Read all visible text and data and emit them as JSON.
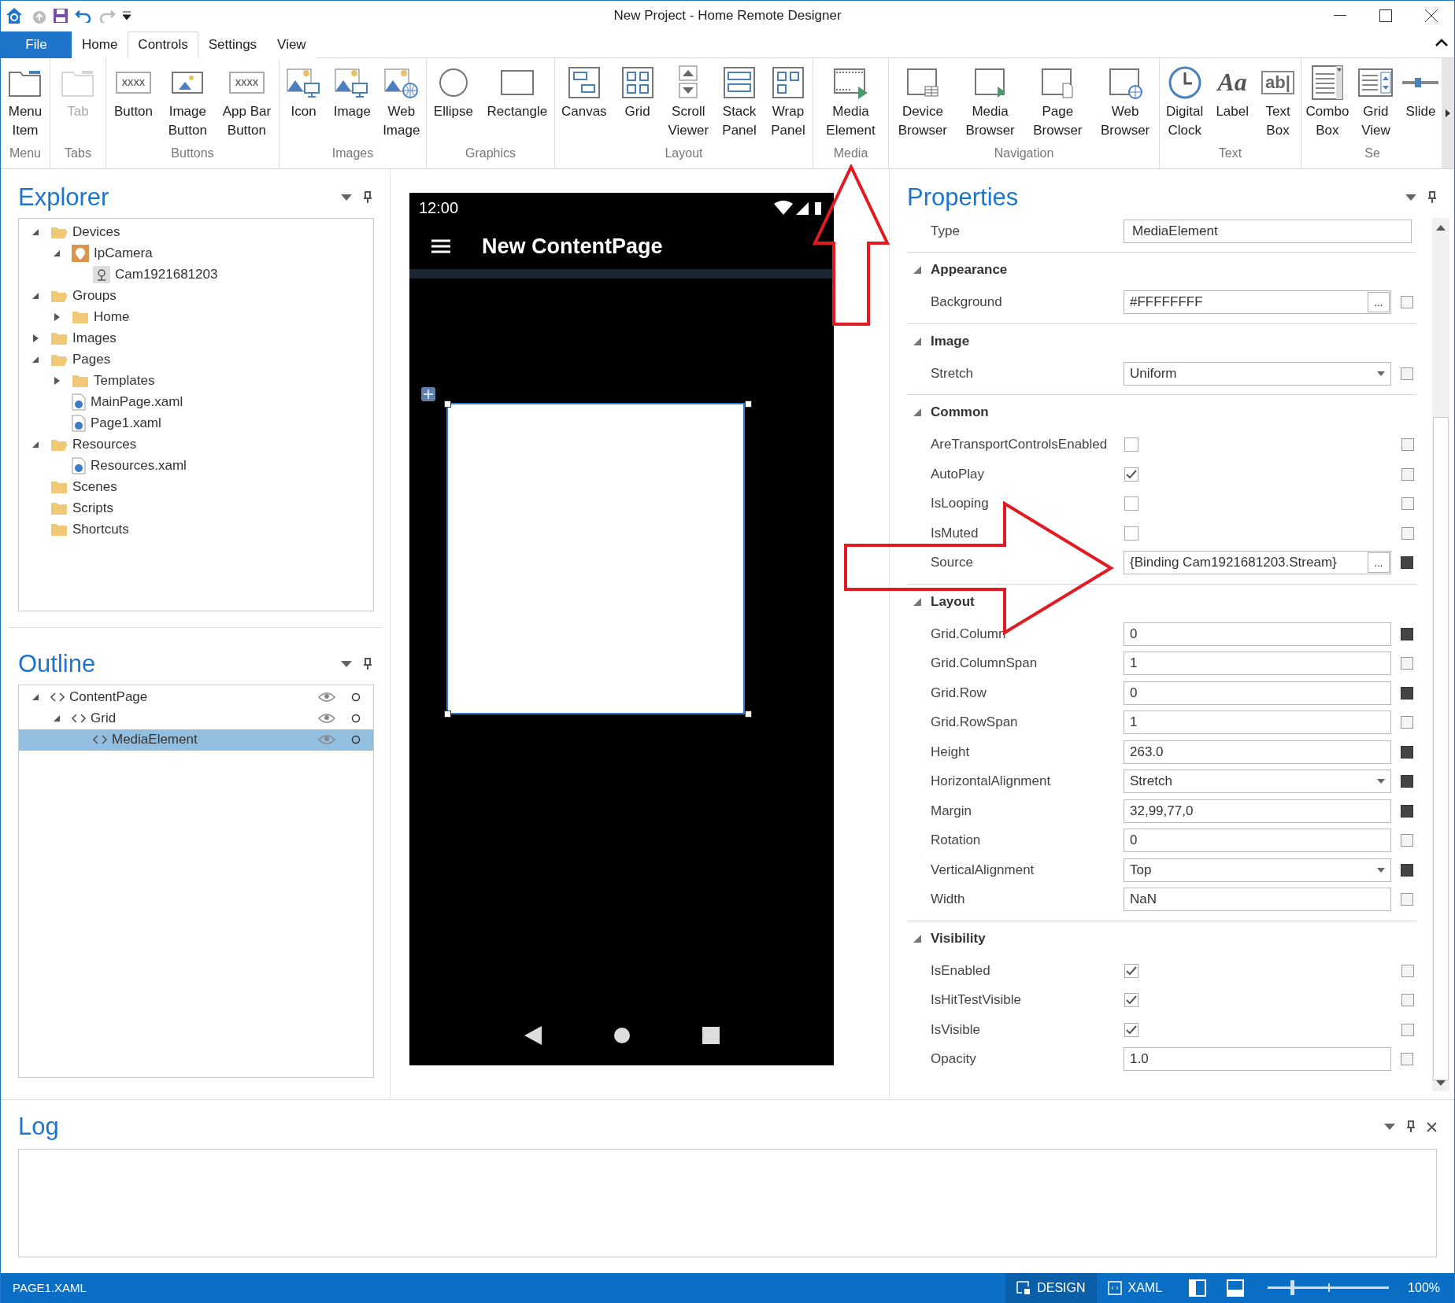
{
  "window": {
    "title": "New Project - Home Remote Designer"
  },
  "ribbon_tabs": [
    {
      "label": "File",
      "kind": "file",
      "selected": false
    },
    {
      "label": "Home",
      "kind": "tab",
      "selected": false
    },
    {
      "label": "Controls",
      "kind": "tab",
      "selected": true
    },
    {
      "label": "Settings",
      "kind": "tab",
      "selected": false
    },
    {
      "label": "View",
      "kind": "tab",
      "selected": false
    }
  ],
  "ribbon_groups": [
    {
      "label": "Menu",
      "items": [
        {
          "label": "Menu\nItem",
          "disabled": false
        }
      ]
    },
    {
      "label": "Tabs",
      "items": [
        {
          "label": "Tab",
          "disabled": true
        }
      ]
    },
    {
      "label": "Buttons",
      "items": [
        {
          "label": "Button",
          "glyph": "XXXX",
          "disabled": false
        },
        {
          "label": "Image\nButton",
          "disabled": false
        },
        {
          "label": "App Bar\nButton",
          "glyph": "XXXX",
          "disabled": false
        }
      ]
    },
    {
      "label": "Images",
      "items": [
        {
          "label": "Icon",
          "disabled": false
        },
        {
          "label": "Image",
          "disabled": false
        },
        {
          "label": "Web\nImage",
          "disabled": false
        }
      ]
    },
    {
      "label": "Graphics",
      "items": [
        {
          "label": "Ellipse",
          "disabled": false
        },
        {
          "label": "Rectangle",
          "disabled": false
        }
      ]
    },
    {
      "label": "Layout",
      "items": [
        {
          "label": "Canvas",
          "disabled": false
        },
        {
          "label": "Grid",
          "disabled": false
        },
        {
          "label": "Scroll\nViewer",
          "disabled": false
        },
        {
          "label": "Stack\nPanel",
          "disabled": false
        },
        {
          "label": "Wrap\nPanel",
          "disabled": false
        }
      ]
    },
    {
      "label": "Media",
      "items": [
        {
          "label": "Media\nElement",
          "disabled": false
        }
      ]
    },
    {
      "label": "Navigation",
      "items": [
        {
          "label": "Device\nBrowser",
          "disabled": false
        },
        {
          "label": "Media\nBrowser",
          "disabled": false
        },
        {
          "label": "Page\nBrowser",
          "disabled": false
        },
        {
          "label": "Web\nBrowser",
          "disabled": false
        }
      ]
    },
    {
      "label": "Text",
      "items": [
        {
          "label": "Digital\nClock",
          "disabled": false
        },
        {
          "label": "Label",
          "glyph": "Aa",
          "disabled": false
        },
        {
          "label": "Text\nBox",
          "glyph": "ab|",
          "disabled": false
        }
      ]
    },
    {
      "label": "Se",
      "items": [
        {
          "label": "Combo\nBox",
          "disabled": false
        },
        {
          "label": "Grid\nView",
          "disabled": false
        },
        {
          "label": "Slide",
          "disabled": false
        }
      ]
    }
  ],
  "explorer": {
    "title": "Explorer",
    "tree": [
      {
        "label": "Devices",
        "kind": "folder",
        "expanded": true,
        "children": [
          {
            "label": "IpCamera",
            "kind": "device",
            "expanded": true,
            "children": [
              {
                "label": "Cam1921681203",
                "kind": "camera"
              }
            ]
          }
        ]
      },
      {
        "label": "Groups",
        "kind": "folder",
        "expanded": true,
        "children": [
          {
            "label": "Home",
            "kind": "folder",
            "expanded": false
          }
        ]
      },
      {
        "label": "Images",
        "kind": "folder",
        "expanded": false
      },
      {
        "label": "Pages",
        "kind": "folder",
        "expanded": true,
        "children": [
          {
            "label": "Templates",
            "kind": "folder",
            "expanded": false
          },
          {
            "label": "MainPage.xaml",
            "kind": "file"
          },
          {
            "label": "Page1.xaml",
            "kind": "file"
          }
        ]
      },
      {
        "label": "Resources",
        "kind": "folder",
        "expanded": true,
        "children": [
          {
            "label": "Resources.xaml",
            "kind": "file"
          }
        ]
      },
      {
        "label": "Scenes",
        "kind": "folder"
      },
      {
        "label": "Scripts",
        "kind": "folder"
      },
      {
        "label": "Shortcuts",
        "kind": "folder"
      }
    ]
  },
  "outline": {
    "title": "Outline",
    "tree": [
      {
        "label": "ContentPage",
        "expanded": true,
        "selected": false,
        "children": [
          {
            "label": "Grid",
            "expanded": true,
            "selected": false,
            "children": [
              {
                "label": "MediaElement",
                "selected": true
              }
            ]
          }
        ]
      }
    ]
  },
  "designer": {
    "time": "12:00",
    "page_title": "New ContentPage"
  },
  "properties": {
    "title": "Properties",
    "type": {
      "label": "Type",
      "value": "MediaElement"
    },
    "sections": [
      {
        "title": "Appearance",
        "expanded": true,
        "rows": [
          {
            "label": "Background",
            "kind": "button-field",
            "value": "#FFFFFFFF",
            "button": "...",
            "set": false
          }
        ]
      },
      {
        "title": "Image",
        "expanded": true,
        "rows": [
          {
            "label": "Stretch",
            "kind": "dropdown",
            "value": "Uniform",
            "set": false
          }
        ]
      },
      {
        "title": "Common",
        "expanded": true,
        "rows": [
          {
            "label": "AreTransportControlsEnabled",
            "kind": "checkbox",
            "checked": false,
            "set": false
          },
          {
            "label": "AutoPlay",
            "kind": "checkbox",
            "checked": true,
            "set": false
          },
          {
            "label": "IsLooping",
            "kind": "checkbox",
            "checked": false,
            "set": false
          },
          {
            "label": "IsMuted",
            "kind": "checkbox",
            "checked": false,
            "set": false
          },
          {
            "label": "Source",
            "kind": "button-field",
            "value": "{Binding Cam1921681203.Stream}",
            "button": "...",
            "set": true
          }
        ]
      },
      {
        "title": "Layout",
        "expanded": true,
        "rows": [
          {
            "label": "Grid.Column",
            "kind": "field",
            "value": "0",
            "set": true
          },
          {
            "label": "Grid.ColumnSpan",
            "kind": "field",
            "value": "1",
            "set": false
          },
          {
            "label": "Grid.Row",
            "kind": "field",
            "value": "0",
            "set": true
          },
          {
            "label": "Grid.RowSpan",
            "kind": "field",
            "value": "1",
            "set": false
          },
          {
            "label": "Height",
            "kind": "field",
            "value": "263.0",
            "set": true
          },
          {
            "label": "HorizontalAlignment",
            "kind": "dropdown",
            "value": "Stretch",
            "set": true
          },
          {
            "label": "Margin",
            "kind": "field",
            "value": "32,99,77,0",
            "set": true
          },
          {
            "label": "Rotation",
            "kind": "field",
            "value": "0",
            "set": false
          },
          {
            "label": "VerticalAlignment",
            "kind": "dropdown",
            "value": "Top",
            "set": true
          },
          {
            "label": "Width",
            "kind": "field",
            "value": "NaN",
            "set": false
          }
        ]
      },
      {
        "title": "Visibility",
        "expanded": true,
        "rows": [
          {
            "label": "IsEnabled",
            "kind": "checkbox",
            "checked": true,
            "set": false
          },
          {
            "label": "IsHitTestVisible",
            "kind": "checkbox",
            "checked": true,
            "set": false
          },
          {
            "label": "IsVisible",
            "kind": "checkbox",
            "checked": true,
            "set": false
          },
          {
            "label": "Opacity",
            "kind": "field",
            "value": "1.0",
            "set": false
          }
        ]
      }
    ]
  },
  "log": {
    "title": "Log"
  },
  "status_bar": {
    "file": "PAGE1.XAML",
    "views": [
      {
        "label": "DESIGN",
        "kind": "design",
        "selected": true
      },
      {
        "label": "XAML",
        "kind": "xaml",
        "selected": false
      }
    ],
    "zoom": {
      "level": 0.2,
      "reading": "100%"
    }
  }
}
